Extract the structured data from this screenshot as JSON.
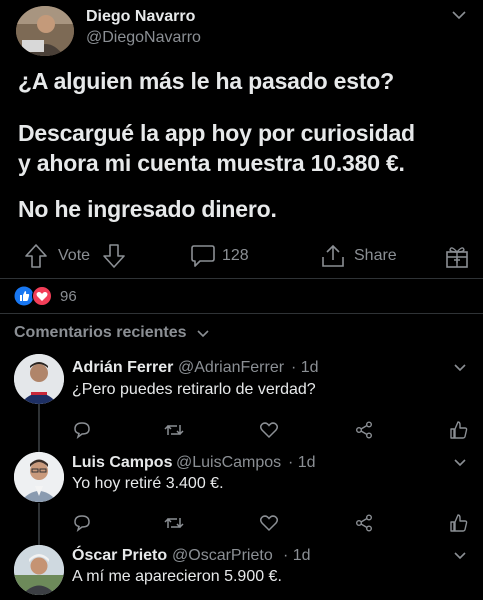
{
  "post": {
    "author_name": "Diego Navarro",
    "author_handle": "@DiegoNavarro",
    "lines": [
      "¿A alguien más le ha pasado esto?",
      "Descargué la app hoy por curiosidad",
      "y ahora mi cuenta muestra 10.380 €.",
      "No he ingresado dinero."
    ],
    "vote_label": "Vote",
    "comment_count": "128",
    "share_label": "Share",
    "reaction_count": "96"
  },
  "comments_header": "Comentarios recientes",
  "comments": [
    {
      "name": "Adrián Ferrer",
      "handle": "@AdrianFerrer",
      "time": "· 1d",
      "text": "¿Pero puedes retirarlo de verdad?"
    },
    {
      "name": "Luis Campos",
      "handle": "@LuisCampos",
      "time": "· 1d",
      "text": "Yo hoy retiré 3.400 €."
    },
    {
      "name": "Óscar Prieto",
      "handle": "@OscarPrieto",
      "time": "· 1d",
      "text": "A mí me aparecieron 5.900 €."
    }
  ],
  "colors": {
    "background": "#000000",
    "text": "#e7e9ea",
    "muted": "#8b8f94",
    "like_blue": "#1877f2",
    "love_red": "#f33e58"
  },
  "icons": [
    "chevron-down-icon",
    "upvote-arrow-icon",
    "downvote-arrow-icon",
    "comment-bubble-icon",
    "share-icon",
    "gift-icon",
    "like-icon",
    "love-icon",
    "reply-icon",
    "retweet-icon",
    "heart-icon",
    "share-nodes-icon",
    "thumbs-up-icon"
  ]
}
